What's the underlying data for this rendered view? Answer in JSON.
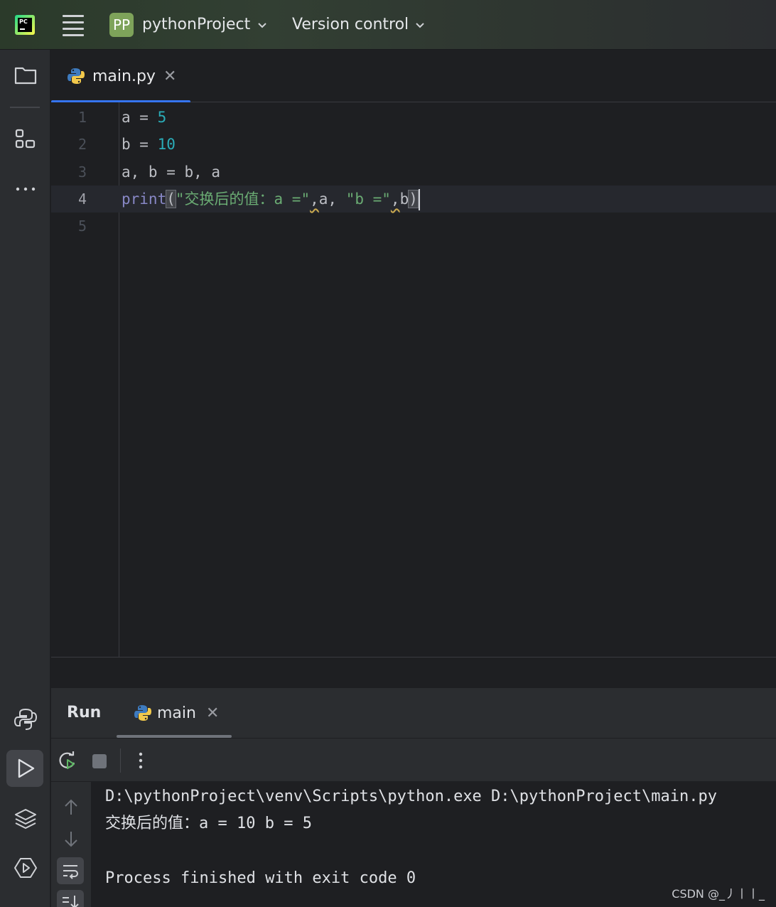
{
  "titlebar": {
    "project_badge": "PP",
    "project_name": "pythonProject",
    "version_control": "Version control"
  },
  "editor": {
    "tab_label": "main.py",
    "lines": [
      {
        "number": "1",
        "code": [
          "a = ",
          "5"
        ]
      },
      {
        "number": "2",
        "code": [
          "b = ",
          "10"
        ]
      },
      {
        "number": "3",
        "code": [
          "a, b = b, a"
        ]
      },
      {
        "number": "4",
        "code": [
          "print",
          "(",
          "\"交换后的值：a =\"",
          ",",
          "a, ",
          "\"b =\"",
          ",",
          "b",
          ")"
        ]
      },
      {
        "number": "5",
        "code": [
          ""
        ]
      }
    ]
  },
  "run_panel": {
    "title": "Run",
    "tab_label": "main",
    "console": [
      "D:\\pythonProject\\venv\\Scripts\\python.exe D:\\pythonProject\\main.py",
      "交换后的值：a = 10 b = 5",
      "",
      "Process finished with exit code 0"
    ]
  },
  "watermark": "CSDN @_丿丨丨_",
  "icons": {
    "app_logo": "pycharm-logo",
    "menu": "hamburger-icon",
    "project_view": "folder-icon",
    "structure": "structure-icon",
    "more": "more-icon",
    "python_console": "python-icon",
    "run": "run-icon",
    "layers": "layers-icon",
    "services": "services-icon"
  },
  "colors": {
    "accent": "#3574f0",
    "number": "#2aacb8",
    "string": "#6aab73",
    "builtin": "#8888c6"
  }
}
